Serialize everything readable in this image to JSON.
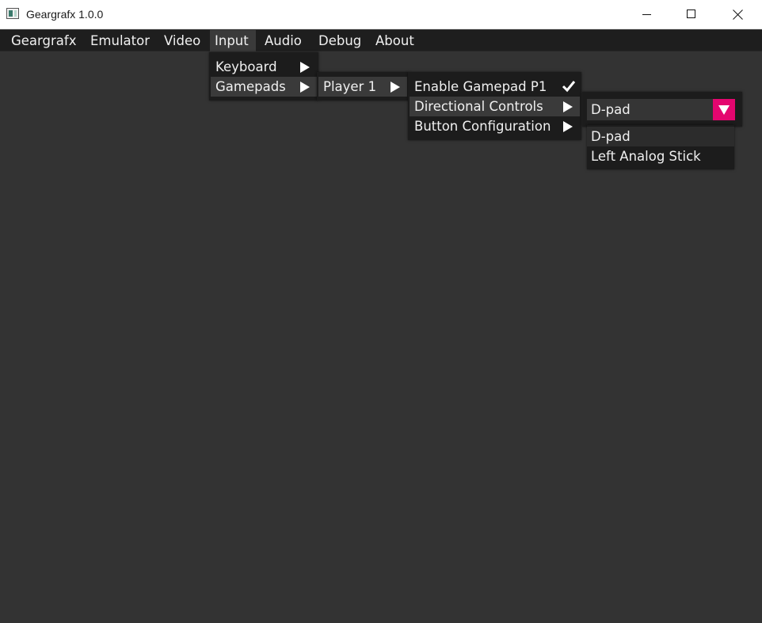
{
  "window": {
    "title": "Geargrafx 1.0.0"
  },
  "menubar": {
    "items": [
      {
        "label": "Geargrafx"
      },
      {
        "label": "Emulator"
      },
      {
        "label": "Video"
      },
      {
        "label": "Input",
        "active": true
      },
      {
        "label": "Audio"
      },
      {
        "label": "Debug"
      },
      {
        "label": "About"
      }
    ]
  },
  "input_menu": {
    "items": [
      {
        "label": "Keyboard",
        "submenu": true
      },
      {
        "label": "Gamepads",
        "submenu": true,
        "highlighted": true
      }
    ]
  },
  "gamepads_menu": {
    "items": [
      {
        "label": "Player 1",
        "submenu": true,
        "highlighted": true
      }
    ]
  },
  "player1_menu": {
    "items": [
      {
        "label": "Enable Gamepad P1",
        "checked": true
      },
      {
        "label": "Directional Controls",
        "submenu": true,
        "highlighted": true
      },
      {
        "label": "Button Configuration",
        "submenu": true
      }
    ]
  },
  "directional_combo": {
    "value": "D-pad",
    "options": [
      "D-pad",
      "Left Analog Stick"
    ],
    "selected_index": 0
  },
  "colors": {
    "background": "#333333",
    "menubar": "#1e1e1e",
    "popup": "#1c1c1c",
    "highlight": "#3a3a3a",
    "accent": "#e4066f",
    "text": "#f0f0f0"
  },
  "icons": {
    "app": "geargrafx-app-icon",
    "minimize": "minimize-icon",
    "maximize": "maximize-icon",
    "close": "close-icon",
    "submenu_arrow": "triangle-right-icon",
    "check": "checkmark-icon",
    "combo_arrow": "triangle-down-icon"
  }
}
